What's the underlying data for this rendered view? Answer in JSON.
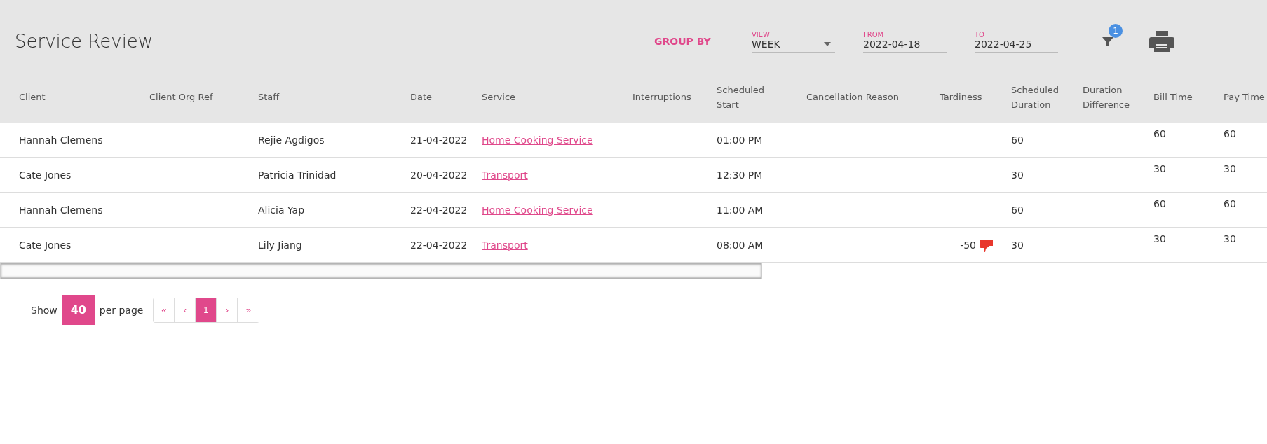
{
  "title": "Service Review",
  "group_by": "GROUP BY",
  "view": {
    "label": "VIEW",
    "value": "WEEK"
  },
  "from": {
    "label": "FROM",
    "value": "2022-04-18"
  },
  "to": {
    "label": "TO",
    "value": "2022-04-25"
  },
  "filter_badge": "1",
  "table": {
    "columns": [
      "Client",
      "Client Org Ref",
      "Staff",
      "Date",
      "Service",
      "Interruptions",
      "Scheduled Start",
      "Cancellation Reason",
      "Tardiness",
      "Scheduled Duration",
      "Duration Difference",
      "Bill Time",
      "Pay Time"
    ],
    "rows": [
      {
        "client": "Hannah Clemens",
        "staff": "Rejie Agdigos",
        "date": "21-04-2022",
        "service": "Home Cooking Service",
        "scheduled_start": "01:00 PM",
        "tardiness": "",
        "scheduled_duration": "60",
        "bill_time": "60",
        "pay_time": "60"
      },
      {
        "client": "Cate Jones",
        "staff": "Patricia Trinidad",
        "date": "20-04-2022",
        "service": "Transport",
        "scheduled_start": "12:30 PM",
        "tardiness": "",
        "scheduled_duration": "30",
        "bill_time": "30",
        "pay_time": "30"
      },
      {
        "client": "Hannah Clemens",
        "staff": "Alicia Yap",
        "date": "22-04-2022",
        "service": "Home Cooking Service",
        "scheduled_start": "11:00 AM",
        "tardiness": "",
        "scheduled_duration": "60",
        "bill_time": "60",
        "pay_time": "60"
      },
      {
        "client": "Cate Jones",
        "staff": "Lily Jiang",
        "date": "22-04-2022",
        "service": "Transport",
        "scheduled_start": "08:00 AM",
        "tardiness": "-50",
        "scheduled_duration": "30",
        "bill_time": "30",
        "pay_time": "30"
      }
    ]
  },
  "pagination": {
    "show": "Show",
    "per_page_value": "40",
    "per_page": "per page",
    "buttons": [
      {
        "label": "«",
        "selected": false
      },
      {
        "label": "‹",
        "selected": false
      },
      {
        "label": "1",
        "selected": true
      },
      {
        "label": "›",
        "selected": false
      },
      {
        "label": "»",
        "selected": false
      }
    ]
  }
}
